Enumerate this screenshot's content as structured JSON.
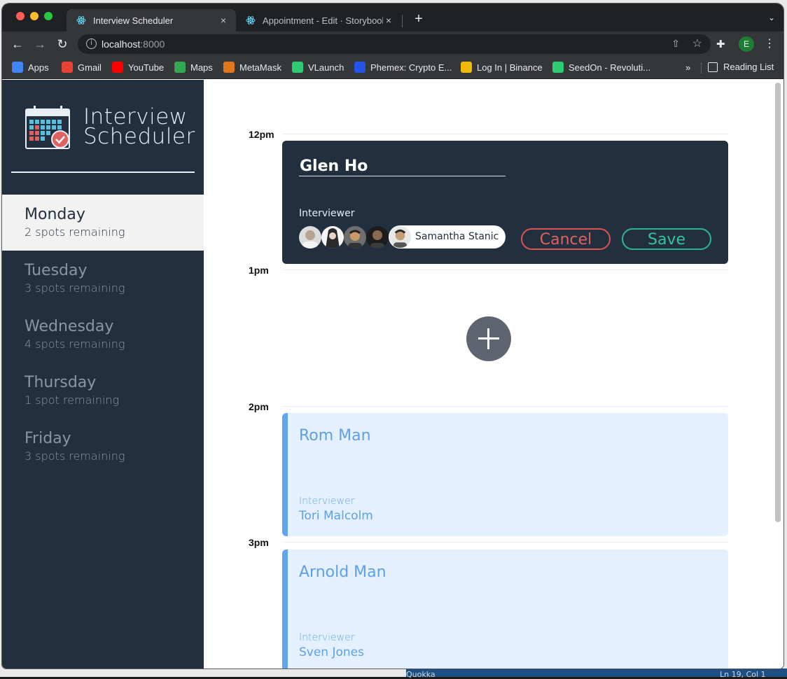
{
  "browser": {
    "tabs": [
      {
        "title": "Interview Scheduler",
        "active": true
      },
      {
        "title": "Appointment - Edit · Storybook",
        "active": false
      }
    ],
    "close_glyph": "×",
    "new_tab_glyph": "+",
    "tab_menu_glyph": "⌄",
    "nav": {
      "back": "←",
      "forward": "→",
      "reload": "↻"
    },
    "url_host": "localhost",
    "url_port": ":8000",
    "info_glyph": "i",
    "share_glyph": "⇧",
    "star_glyph": "☆",
    "extensions_glyph": "✚",
    "profile_initial": "E",
    "menu_glyph": "⋮",
    "bookmarks": [
      {
        "label": "Apps",
        "color": "#4285f4"
      },
      {
        "label": "Gmail",
        "color": "#ea4335"
      },
      {
        "label": "YouTube",
        "color": "#ff0000"
      },
      {
        "label": "Maps",
        "color": "#34a853"
      },
      {
        "label": "MetaMask",
        "color": "#e2761b"
      },
      {
        "label": "VLaunch",
        "color": "#2ecc71"
      },
      {
        "label": "Phemex: Crypto E...",
        "color": "#2354e6"
      },
      {
        "label": "Log In | Binance",
        "color": "#f0b90b"
      },
      {
        "label": "SeedOn - Revoluti...",
        "color": "#2ecc71"
      }
    ],
    "bookmarks_more": "»",
    "reading_list": "Reading List"
  },
  "app": {
    "brand_line1": "Interview",
    "brand_line2": "Scheduler",
    "days": [
      {
        "name": "Monday",
        "spots": "2 spots remaining",
        "selected": true
      },
      {
        "name": "Tuesday",
        "spots": "3 spots remaining",
        "selected": false
      },
      {
        "name": "Wednesday",
        "spots": "4 spots remaining",
        "selected": false
      },
      {
        "name": "Thursday",
        "spots": "1 spot remaining",
        "selected": false
      },
      {
        "name": "Friday",
        "spots": "3 spots remaining",
        "selected": false
      }
    ],
    "times": [
      "12pm",
      "1pm",
      "2pm",
      "3pm"
    ],
    "form": {
      "student_value": "Glen Ho",
      "interviewer_label": "Interviewer",
      "selected_interviewer": "Samantha Stanic",
      "cancel_label": "Cancel",
      "save_label": "Save"
    },
    "appointments": [
      {
        "student": "Rom Man",
        "interviewer_label": "Interviewer",
        "interviewer": "Tori Malcolm"
      },
      {
        "student": "Arnold Man",
        "interviewer_label": "Interviewer",
        "interviewer": "Sven Jones"
      }
    ]
  },
  "background_window": {
    "left_text": "Quokka",
    "right_text": "Ln 19, Col 1"
  },
  "colors": {
    "sidebar": "#222f3e",
    "selected_day": "#f2f2f2",
    "cancel": "#d9534f",
    "save": "#2cb48e",
    "card_bg": "#e4f0fd",
    "card_accent": "#5fa5f0"
  }
}
